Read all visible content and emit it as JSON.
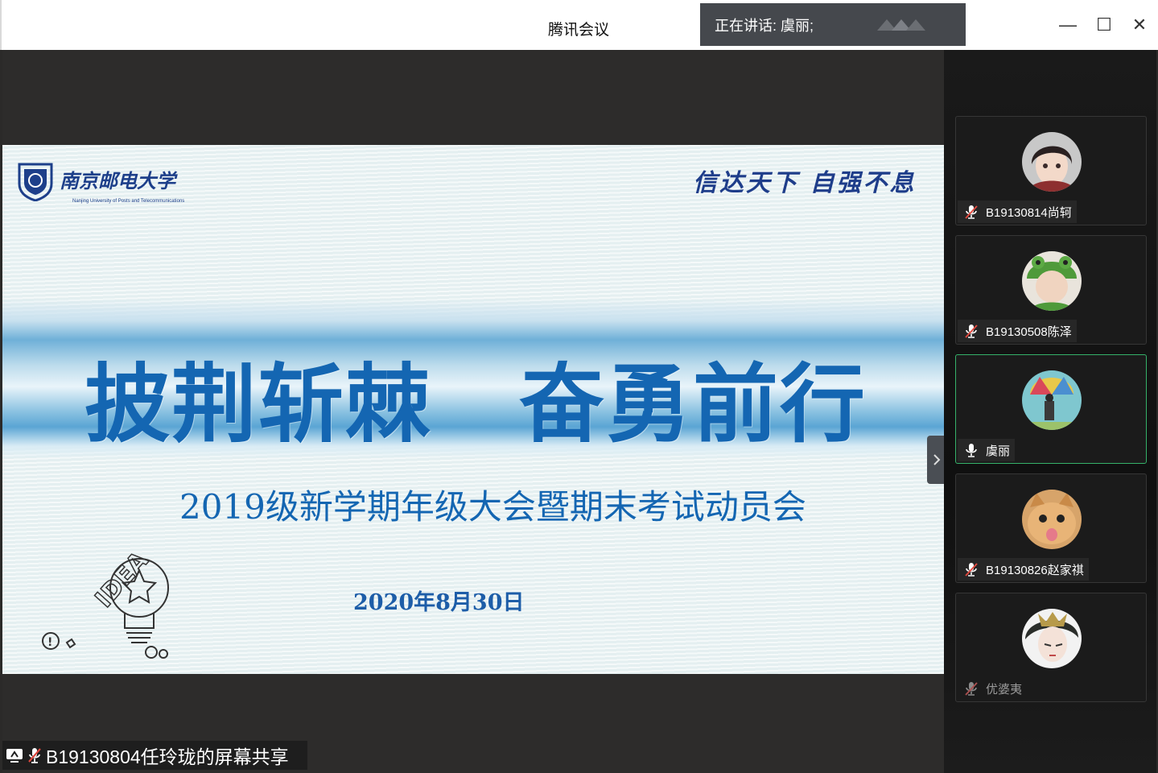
{
  "window": {
    "title": "腾讯会议",
    "speaking_label": "正在讲话: 虞丽;",
    "minimize_symbol": "—",
    "maximize_symbol": "☐",
    "close_symbol": "✕"
  },
  "slide": {
    "university_name": "南京邮电大学",
    "university_english": "Nanjing University of Posts and Telecommunications",
    "motto": "信达天下 自强不息",
    "title": "披荆斩棘　奋勇前行",
    "subtitle": "2019级新学期年级大会暨期末考试动员会",
    "date": "2020年8月30日",
    "idea_text": "IDEA"
  },
  "screen_share": {
    "label": "B19130804任玲珑的屏幕共享",
    "icons": [
      "screen-share-icon",
      "mic-muted-icon"
    ]
  },
  "participants": [
    {
      "name": "B19130814尚轲",
      "mic": "muted",
      "active": false
    },
    {
      "name": "B19130508陈泽",
      "mic": "muted",
      "active": false
    },
    {
      "name": "虞丽",
      "mic": "on",
      "active": true
    },
    {
      "name": "B19130826赵家祺",
      "mic": "muted",
      "active": false
    },
    {
      "name": "优婆夷",
      "mic": "muted",
      "active": false
    }
  ],
  "colors": {
    "accent_active": "#35b26a",
    "slide_blue": "#1466b2",
    "muted_red": "#e0483e"
  }
}
